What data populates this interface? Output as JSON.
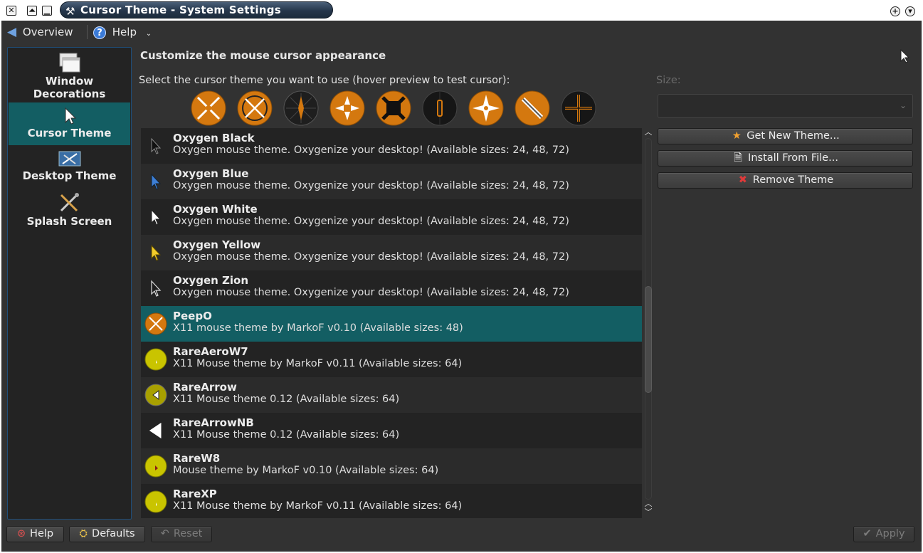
{
  "window": {
    "title": "Cursor Theme - System Settings"
  },
  "toolbar": {
    "overview_label": "Overview",
    "help_label": "Help"
  },
  "sidebar": {
    "items": [
      {
        "label": "Window Decorations",
        "icon": "window-decorations-icon",
        "active": false
      },
      {
        "label": "Cursor Theme",
        "icon": "cursor-icon",
        "active": true
      },
      {
        "label": "Desktop Theme",
        "icon": "desktop-theme-icon",
        "active": false
      },
      {
        "label": "Splash Screen",
        "icon": "splash-screen-icon",
        "active": false
      }
    ]
  },
  "main": {
    "heading": "Customize the mouse cursor appearance",
    "select_label": "Select the cursor theme you want to use (hover preview to test cursor):",
    "size_label": "Size:",
    "size_value": "",
    "buttons": {
      "get_new": "Get New Theme...",
      "install": "Install From File...",
      "remove": "Remove Theme"
    }
  },
  "themes": [
    {
      "name": "Oxygen Black",
      "desc": "Oxygen mouse theme. Oxygenize your desktop! (Available sizes: 24, 48, 72)",
      "icon": "black-arrow"
    },
    {
      "name": "Oxygen Blue",
      "desc": "Oxygen mouse theme. Oxygenize your desktop! (Available sizes: 24, 48, 72)",
      "icon": "blue-arrow"
    },
    {
      "name": "Oxygen White",
      "desc": "Oxygen mouse theme. Oxygenize your desktop! (Available sizes: 24, 48, 72)",
      "icon": "white-arrow"
    },
    {
      "name": "Oxygen Yellow",
      "desc": "Oxygen mouse theme. Oxygenize your desktop! (Available sizes: 24, 48, 72)",
      "icon": "yellow-arrow"
    },
    {
      "name": "Oxygen Zion",
      "desc": "Oxygen mouse theme. Oxygenize your desktop! (Available sizes: 24, 48, 72)",
      "icon": "outline-arrow"
    },
    {
      "name": "PeepO",
      "desc": "X11 mouse theme by MarkoF v0.10 (Available sizes: 48)",
      "icon": "peepo-circle"
    },
    {
      "name": "RareAeroW7",
      "desc": "X11 Mouse theme by MarkoF v0.11 (Available sizes: 64)",
      "icon": "yellow-circle"
    },
    {
      "name": "RareArrow",
      "desc": "X11 Mouse theme 0.12 (Available sizes: 64)",
      "icon": "olive-circle"
    },
    {
      "name": "RareArrowNB",
      "desc": "X11 Mouse theme 0.12 (Available sizes: 64)",
      "icon": "white-big-arrow"
    },
    {
      "name": "RareW8",
      "desc": "Mouse theme by MarkoF v0.10 (Available sizes: 64)",
      "icon": "yellow-circle-red"
    },
    {
      "name": "RareXP",
      "desc": "X11 Mouse theme by MarkoF v0.11 (Available sizes: 64)",
      "icon": "yellow-circle"
    }
  ],
  "selected_theme": "PeepO",
  "bottom": {
    "help": "Help",
    "defaults": "Defaults",
    "reset": "Reset",
    "apply": "Apply"
  },
  "colors": {
    "selection": "#135e63",
    "preview_orange": "#d4780f",
    "background": "#323232"
  }
}
